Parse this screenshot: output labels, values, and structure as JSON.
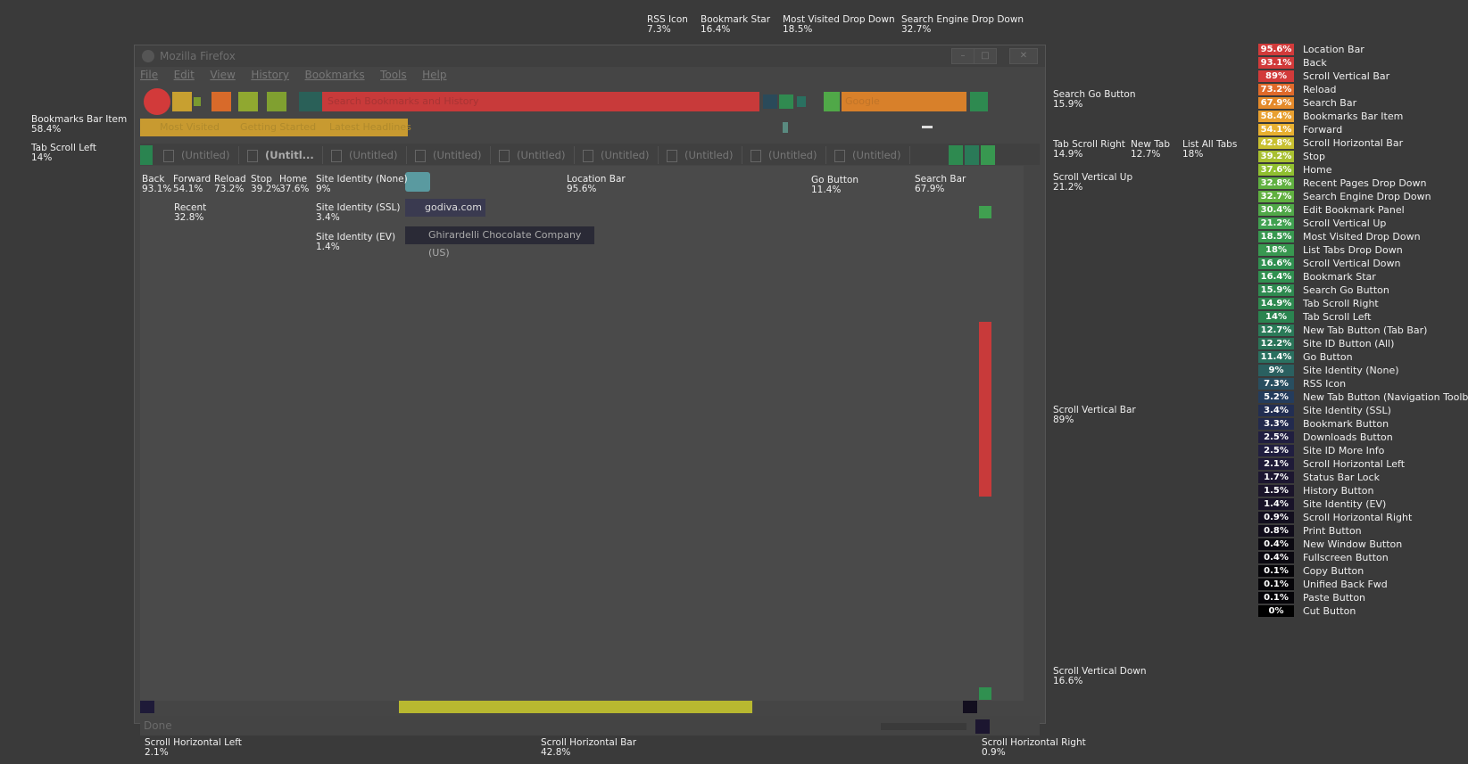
{
  "window": {
    "title": "Mozilla Firefox",
    "menu": [
      "File",
      "Edit",
      "View",
      "History",
      "Bookmarks",
      "Tools",
      "Help"
    ],
    "tabs": [
      "(Untitled)",
      "(Untitl...",
      "(Untitled)",
      "(Untitled)",
      "(Untitled)",
      "(Untitled)",
      "(Untitled)",
      "(Untitled)",
      "(Untitled)"
    ],
    "bookmarks": [
      "Most Visited",
      "Getting Started",
      "Latest Headlines"
    ],
    "location_placeholder": "Search Bookmarks and History",
    "search_placeholder": "Google",
    "site_ssl": "godiva.com",
    "site_ev": "Ghirardelli Chocolate Company (US)",
    "status": "Done"
  },
  "overlay_labels": {
    "rss": {
      "name": "RSS Icon",
      "pct": "7.3%"
    },
    "bookmark_star": {
      "name": "Bookmark Star",
      "pct": "16.4%"
    },
    "most_visited_dd": {
      "name": "Most Visited Drop Down",
      "pct": "18.5%"
    },
    "search_engine_dd": {
      "name": "Search Engine Drop Down",
      "pct": "32.7%"
    },
    "bookmarks_bar_item": {
      "name": "Bookmarks Bar Item",
      "pct": "58.4%"
    },
    "tab_scroll_left": {
      "name": "Tab Scroll Left",
      "pct": "14%"
    },
    "search_go": {
      "name": "Search Go Button",
      "pct": "15.9%"
    },
    "tab_scroll_right": {
      "name": "Tab Scroll Right",
      "pct": "14.9%"
    },
    "new_tab": {
      "name": "New Tab",
      "pct": "12.7%"
    },
    "list_all_tabs": {
      "name": "List All Tabs",
      "pct": "18%"
    },
    "scroll_v_up": {
      "name": "Scroll Vertical Up",
      "pct": "21.2%"
    },
    "scroll_v_bar": {
      "name": "Scroll Vertical Bar",
      "pct": "89%"
    },
    "scroll_v_down": {
      "name": "Scroll Vertical Down",
      "pct": "16.6%"
    },
    "back": {
      "name": "Back",
      "pct": "93.1%"
    },
    "forward": {
      "name": "Forward",
      "pct": "54.1%"
    },
    "reload": {
      "name": "Reload",
      "pct": "73.2%"
    },
    "stop": {
      "name": "Stop",
      "pct": "39.2%"
    },
    "home": {
      "name": "Home",
      "pct": "37.6%"
    },
    "recent": {
      "name": "Recent",
      "pct": "32.8%"
    },
    "site_id_none": {
      "name": "Site Identity (None)",
      "pct": "9%"
    },
    "site_id_ssl": {
      "name": "Site Identity (SSL)",
      "pct": "3.4%"
    },
    "site_id_ev": {
      "name": "Site Identity (EV)",
      "pct": "1.4%"
    },
    "location_bar": {
      "name": "Location Bar",
      "pct": "95.6%"
    },
    "go_button": {
      "name": "Go Button",
      "pct": "11.4%"
    },
    "search_bar": {
      "name": "Search Bar",
      "pct": "67.9%"
    },
    "scroll_h_left": {
      "name": "Scroll Horizontal Left",
      "pct": "2.1%"
    },
    "scroll_h_bar": {
      "name": "Scroll Horizontal Bar",
      "pct": "42.8%"
    },
    "scroll_h_right": {
      "name": "Scroll Horizontal Right",
      "pct": "0.9%"
    }
  },
  "legend": [
    {
      "pct": "95.6%",
      "name": "Location Bar",
      "color": "#d23a3a"
    },
    {
      "pct": "93.1%",
      "name": "Back",
      "color": "#d23a3a"
    },
    {
      "pct": "89%",
      "name": "Scroll Vertical Bar",
      "color": "#d23a3a"
    },
    {
      "pct": "73.2%",
      "name": "Reload",
      "color": "#e06a2a"
    },
    {
      "pct": "67.9%",
      "name": "Search Bar",
      "color": "#e58a2a"
    },
    {
      "pct": "58.4%",
      "name": "Bookmarks Bar Item",
      "color": "#e8a030"
    },
    {
      "pct": "54.1%",
      "name": "Forward",
      "color": "#e8b030"
    },
    {
      "pct": "42.8%",
      "name": "Scroll Horizontal Bar",
      "color": "#c8c030"
    },
    {
      "pct": "39.2%",
      "name": "Stop",
      "color": "#a8c030"
    },
    {
      "pct": "37.6%",
      "name": "Home",
      "color": "#90c030"
    },
    {
      "pct": "32.8%",
      "name": "Recent Pages Drop Down",
      "color": "#60b040"
    },
    {
      "pct": "32.7%",
      "name": "Search Engine Drop Down",
      "color": "#60b040"
    },
    {
      "pct": "30.4%",
      "name": "Edit Bookmark Panel",
      "color": "#50a848"
    },
    {
      "pct": "21.2%",
      "name": "Scroll Vertical Up",
      "color": "#40a050"
    },
    {
      "pct": "18.5%",
      "name": "Most Visited Drop Down",
      "color": "#389850"
    },
    {
      "pct": "18%",
      "name": "List Tabs Drop Down",
      "color": "#389850"
    },
    {
      "pct": "16.6%",
      "name": "Scroll Vertical Down",
      "color": "#309050"
    },
    {
      "pct": "16.4%",
      "name": "Bookmark Star",
      "color": "#309050"
    },
    {
      "pct": "15.9%",
      "name": "Search Go Button",
      "color": "#2e8a50"
    },
    {
      "pct": "14.9%",
      "name": "Tab Scroll Right",
      "color": "#2e8a50"
    },
    {
      "pct": "14%",
      "name": "Tab Scroll Left",
      "color": "#2a8450"
    },
    {
      "pct": "12.7%",
      "name": "New Tab Button (Tab Bar)",
      "color": "#2a7a58"
    },
    {
      "pct": "12.2%",
      "name": "Site ID Button (All)",
      "color": "#2a7458"
    },
    {
      "pct": "11.4%",
      "name": "Go Button",
      "color": "#2a7060"
    },
    {
      "pct": "9%",
      "name": "Site Identity (None)",
      "color": "#2a6060"
    },
    {
      "pct": "7.3%",
      "name": "RSS Icon",
      "color": "#284e60"
    },
    {
      "pct": "5.2%",
      "name": "New Tab Button (Navigation Toolbar)",
      "color": "#243c5c"
    },
    {
      "pct": "3.4%",
      "name": "Site Identity (SSL)",
      "color": "#222e52"
    },
    {
      "pct": "3.3%",
      "name": "Bookmark Button",
      "color": "#222a4e"
    },
    {
      "pct": "2.5%",
      "name": "Downloads Button",
      "color": "#201e40"
    },
    {
      "pct": "2.5%",
      "name": "Site ID More Info",
      "color": "#201e40"
    },
    {
      "pct": "2.1%",
      "name": "Scroll Horizontal Left",
      "color": "#1e1a38"
    },
    {
      "pct": "1.7%",
      "name": "Status Bar Lock",
      "color": "#1c1630"
    },
    {
      "pct": "1.5%",
      "name": "History Button",
      "color": "#1a142a"
    },
    {
      "pct": "1.4%",
      "name": "Site Identity (EV)",
      "color": "#181228"
    },
    {
      "pct": "0.9%",
      "name": "Scroll Horizontal Right",
      "color": "#120e1e"
    },
    {
      "pct": "0.8%",
      "name": "Print Button",
      "color": "#100c1a"
    },
    {
      "pct": "0.4%",
      "name": "New Window Button",
      "color": "#0a0810"
    },
    {
      "pct": "0.4%",
      "name": "Fullscreen Button",
      "color": "#0a0810"
    },
    {
      "pct": "0.1%",
      "name": "Copy Button",
      "color": "#050408"
    },
    {
      "pct": "0.1%",
      "name": "Unified Back Fwd",
      "color": "#050408"
    },
    {
      "pct": "0.1%",
      "name": "Paste Button",
      "color": "#050408"
    },
    {
      "pct": "0%",
      "name": "Cut Button",
      "color": "#000000"
    }
  ]
}
